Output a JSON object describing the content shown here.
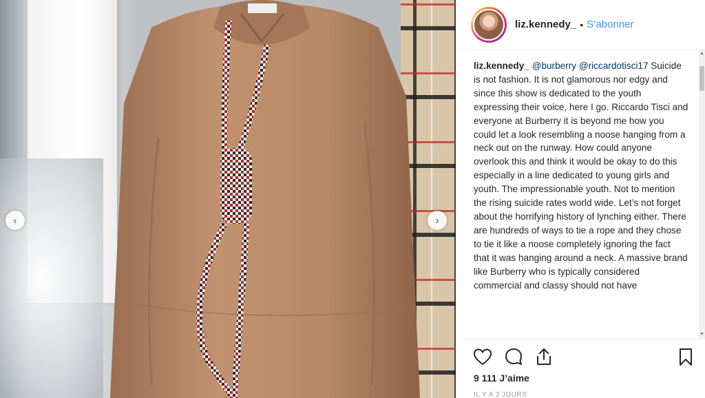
{
  "post": {
    "username": "liz.kennedy_",
    "separator": "•",
    "follow_label": "S’abonner",
    "caption": {
      "username": "liz.kennedy_",
      "mentions": [
        "@burberry",
        "@riccardotisci17"
      ],
      "text": "Suicide is not fashion. It is not glamorous nor edgy and since this show is dedicated to the youth expressing their voice, here I go. Riccardo Tisci and everyone at Burberry it is beyond me how you could let a look resembling a noose hanging from a neck out on the runway. How could anyone overlook this and think it would be okay to do this especially in a line dedicated to young girls and youth. The impressionable youth. Not to mention the rising suicide rates world wide. Let’s not forget about the horrifying history of lynching either. There are hundreds of ways to tie a rope and they chose to tie it like a noose completely ignoring the fact that it was hanging around a neck. A massive brand like Burberry who is typically considered commercial and classy should not have"
    },
    "likes": "9 111 J’aime",
    "time_ago": "IL Y A 3 JOURS"
  },
  "media": {
    "prev_icon": "chevron-left-icon",
    "next_icon": "chevron-right-icon",
    "prev_glyph": "‹",
    "next_glyph": "›"
  },
  "actions": {
    "like_icon": "heart-icon",
    "comment_icon": "comment-icon",
    "share_icon": "share-icon",
    "save_icon": "bookmark-icon"
  },
  "colors": {
    "link_blue": "#3897f0",
    "mention_blue": "#003569",
    "text": "#262626",
    "hoodie": "#b98a6a"
  }
}
